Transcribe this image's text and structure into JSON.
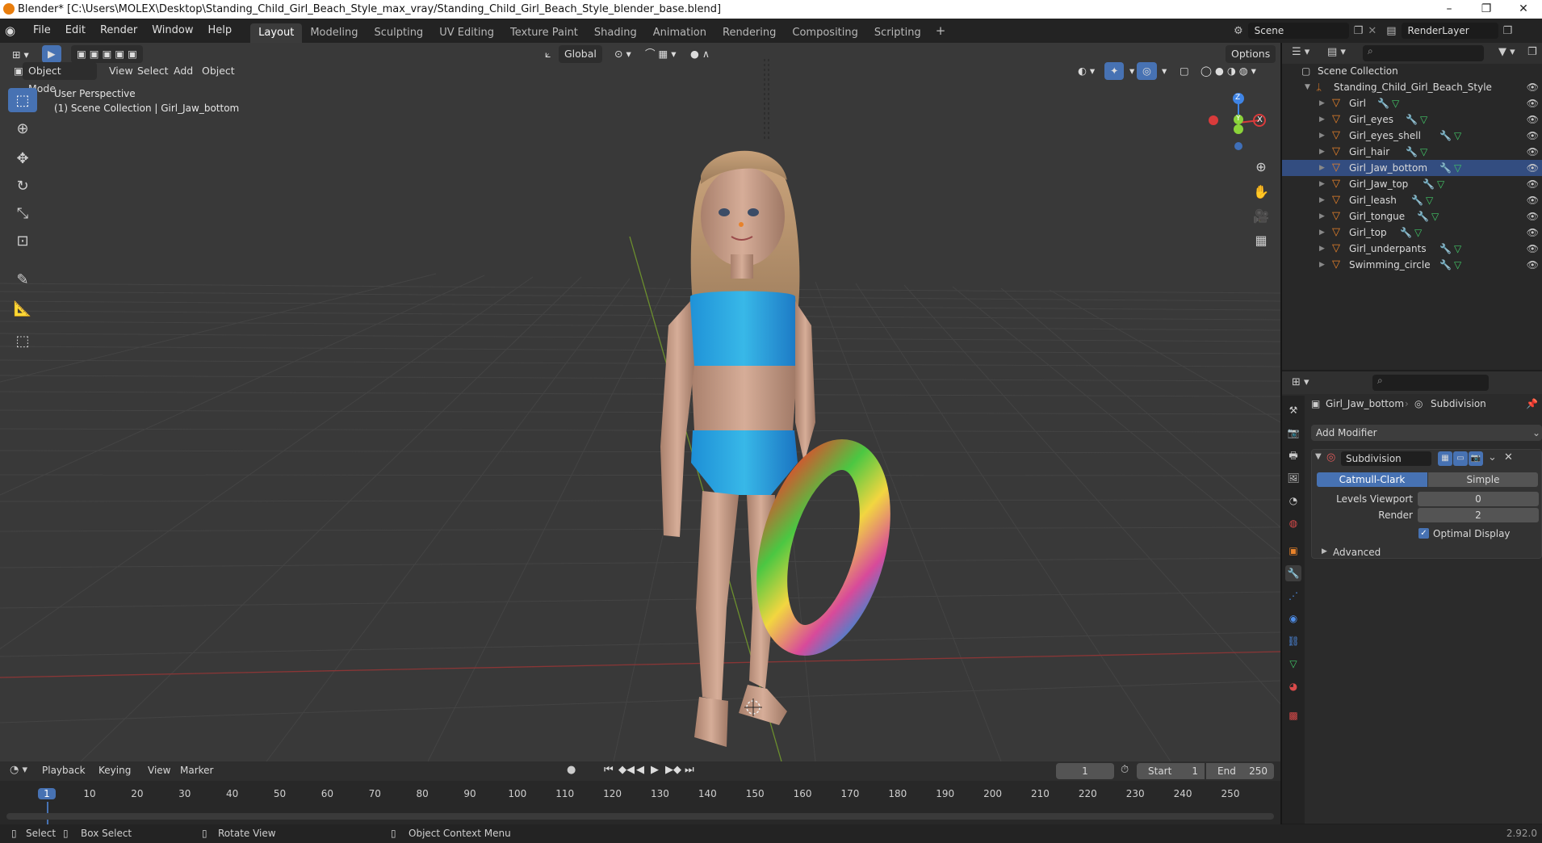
{
  "title_bar": {
    "text": "Blender* [C:\\Users\\MOLEX\\Desktop\\Standing_Child_Girl_Beach_Style_max_vray/Standing_Child_Girl_Beach_Style_blender_base.blend]",
    "minimize": "–",
    "restore": "❐",
    "close": "✕"
  },
  "menu": {
    "file": "File",
    "edit": "Edit",
    "render": "Render",
    "window": "Window",
    "help": "Help"
  },
  "workspaces": [
    "Layout",
    "Modeling",
    "Sculpting",
    "UV Editing",
    "Texture Paint",
    "Shading",
    "Animation",
    "Rendering",
    "Compositing",
    "Scripting"
  ],
  "workspace_add": "+",
  "scene": {
    "name": "Scene",
    "render_layer": "RenderLayer"
  },
  "viewport": {
    "transform_orientation": "Global",
    "options_label": "Options",
    "mode": "Object Mode",
    "view": "View",
    "select": "Select",
    "add": "Add",
    "object": "Object",
    "overlay_title": "User Perspective",
    "overlay_sub": "(1) Scene Collection | Girl_Jaw_bottom",
    "axis_z": "Z",
    "axis_x": "X",
    "axis_y": "Y"
  },
  "outliner": {
    "root": "Scene Collection",
    "collection": "Standing_Child_Girl_Beach_Style",
    "objects": [
      "Girl",
      "Girl_eyes",
      "Girl_eyes_shell",
      "Girl_hair",
      "Girl_Jaw_bottom",
      "Girl_Jaw_top",
      "Girl_leash",
      "Girl_tongue",
      "Girl_top",
      "Girl_underpants",
      "Swimming_circle"
    ],
    "active_index": 4
  },
  "properties": {
    "object": "Girl_Jaw_bottom",
    "modifier_crumb": "Subdivision",
    "add_modifier": "Add Modifier",
    "modifier_name": "Subdivision",
    "catmull": "Catmull-Clark",
    "simple": "Simple",
    "levels_label": "Levels Viewport",
    "levels_value": "0",
    "render_label": "Render",
    "render_value": "2",
    "optimal_label": "Optimal Display",
    "optimal_checked": true,
    "advanced": "Advanced"
  },
  "timeline": {
    "playback": "Playback",
    "keying": "Keying",
    "view": "View",
    "marker": "Marker",
    "current_frame": "1",
    "start_label": "Start",
    "start_value": "1",
    "end_label": "End",
    "end_value": "250",
    "ticks": [
      "1",
      "10",
      "20",
      "30",
      "40",
      "50",
      "60",
      "70",
      "80",
      "90",
      "100",
      "110",
      "120",
      "130",
      "140",
      "150",
      "160",
      "170",
      "180",
      "190",
      "200",
      "210",
      "220",
      "230",
      "240",
      "250"
    ]
  },
  "status": {
    "select": "Select",
    "box_select": "Box Select",
    "rotate_view": "Rotate View",
    "context_menu": "Object Context Menu",
    "version": "2.92.0"
  },
  "colors": {
    "accent": "#4772b3",
    "mesh_orange": "#e8822a",
    "mesh_green": "#42c868",
    "x_axis": "#d93b3b",
    "y_axis": "#8bd33a",
    "z_axis": "#3f84e5"
  }
}
